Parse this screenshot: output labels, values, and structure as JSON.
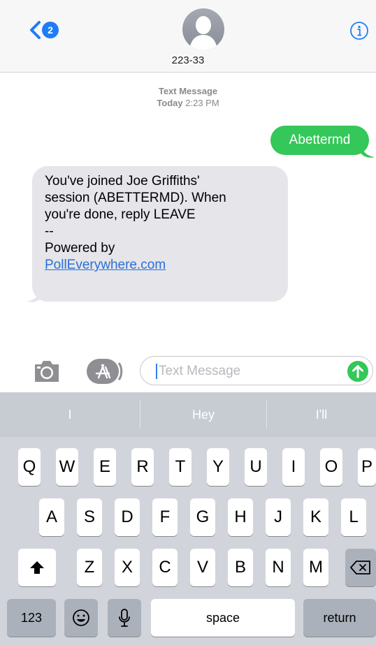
{
  "header": {
    "back_badge": "2",
    "contact_name": "223-33"
  },
  "conversation": {
    "service": "Text Message",
    "timestamp_day": "Today",
    "timestamp_time": "2:23 PM",
    "sent": "Abettermd",
    "received": {
      "lines": [
        "You've joined Joe Griffiths'",
        "session (ABETTERMD). When",
        "you're done, reply LEAVE",
        "--",
        "Powered by"
      ],
      "link": "PollEverywhere.com"
    }
  },
  "input": {
    "placeholder": "Text Message"
  },
  "keyboard": {
    "predictions": [
      "I",
      "Hey",
      "I'll"
    ],
    "row1": [
      "Q",
      "W",
      "E",
      "R",
      "T",
      "Y",
      "U",
      "I",
      "O",
      "P"
    ],
    "row2": [
      "A",
      "S",
      "D",
      "F",
      "G",
      "H",
      "J",
      "K",
      "L"
    ],
    "row3": [
      "Z",
      "X",
      "C",
      "V",
      "B",
      "N",
      "M"
    ],
    "numbers_key": "123",
    "space_key": "space",
    "return_key": "return"
  },
  "icons": {
    "back": "chevron-left-icon",
    "info": "info-icon",
    "camera": "camera-icon",
    "apps": "app-store-icon",
    "send": "arrow-up-icon",
    "shift": "shift-icon",
    "delete": "delete-icon",
    "emoji": "emoji-icon",
    "dictation": "microphone-icon"
  },
  "colors": {
    "accent": "#1e7cf6",
    "sent_bubble": "#34c759",
    "received_bubble": "#e5e5ea",
    "keyboard_bg": "#d1d4da"
  }
}
